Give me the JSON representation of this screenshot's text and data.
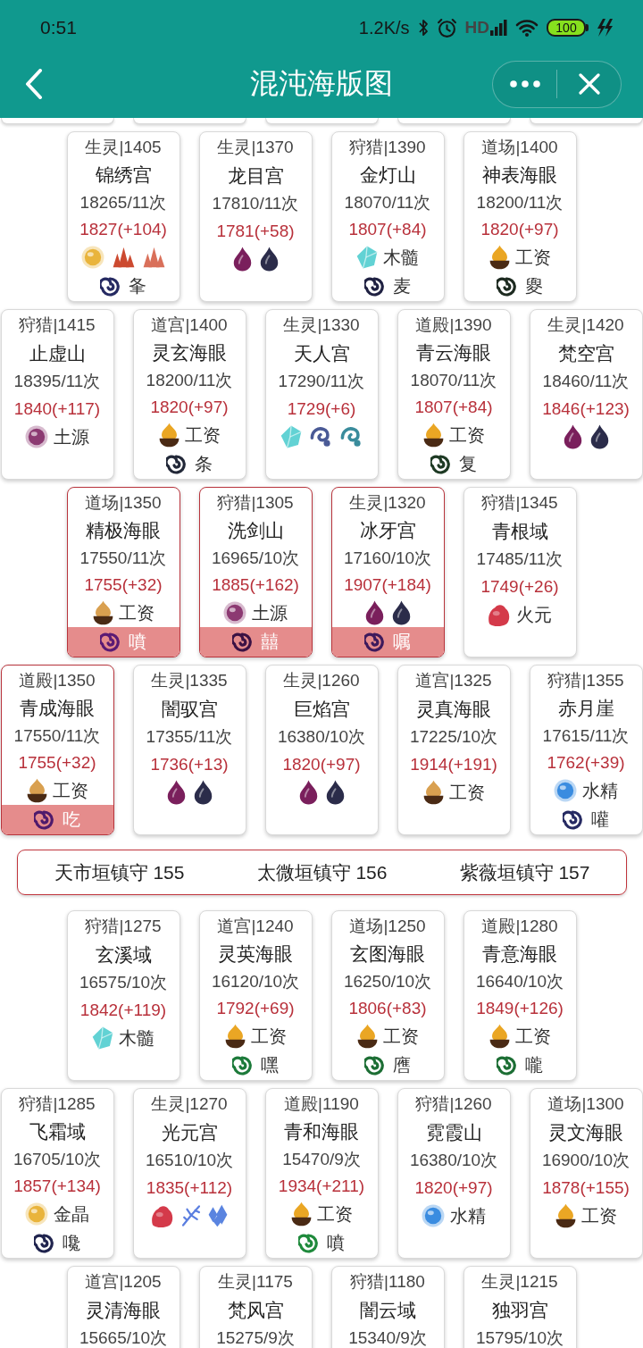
{
  "status_bar": {
    "time": "0:51",
    "net_speed": "1.2K/s",
    "signal_label": "HD",
    "battery": "100"
  },
  "nav": {
    "title": "混沌海版图"
  },
  "clipped_row": [
    {
      "kind": "card"
    },
    {
      "kind": "card"
    },
    {
      "kind": "card"
    },
    {
      "kind": "card"
    },
    {
      "kind": "card"
    }
  ],
  "rows": [
    {
      "kind": "cards",
      "cards": [
        {
          "header": "生灵|1405",
          "name": "锦绣宫",
          "count": "18265/11次",
          "power": "1827(+104)",
          "highlighted": false,
          "rewards": [
            {
              "kind": "orb",
              "color": "#e9b43c"
            },
            {
              "kind": "shards",
              "color": "#cc4a30"
            },
            {
              "kind": "shards",
              "color": "#d9705a"
            }
          ],
          "guard": {
            "label": "夆",
            "color": "#262a62"
          }
        },
        {
          "header": "生灵|1370",
          "name": "龙目宫",
          "count": "17810/11次",
          "power": "1781(+58)",
          "highlighted": false,
          "rewards": [
            {
              "kind": "flame",
              "color": "#7a1f5c"
            },
            {
              "kind": "flame",
              "color": "#2b2c4a"
            }
          ]
        },
        {
          "header": "狩猎|1390",
          "name": "金灯山",
          "count": "18070/11次",
          "power": "1807(+84)",
          "highlighted": false,
          "rewards": [
            {
              "kind": "crystal",
              "color": "#62d2d4",
              "label": "木髓"
            }
          ],
          "guard": {
            "label": "麦",
            "color": "#1f2142"
          }
        },
        {
          "header": "道场|1400",
          "name": "神表海眼",
          "count": "18200/11次",
          "power": "1820(+97)",
          "highlighted": false,
          "rewards": [
            {
              "kind": "bowl",
              "color": "#eaa624",
              "label": "工资"
            }
          ],
          "guard": {
            "label": "夓",
            "color": "#1d2a20"
          }
        }
      ]
    },
    {
      "kind": "cards",
      "cards": [
        {
          "header": "狩猎|1415",
          "name": "止虚山",
          "count": "18395/11次",
          "power": "1840(+117)",
          "highlighted": false,
          "rewards": [
            {
              "kind": "orb",
              "color": "#8c3a72",
              "label": "土源"
            }
          ]
        },
        {
          "header": "道宫|1400",
          "name": "灵玄海眼",
          "count": "18200/11次",
          "power": "1820(+97)",
          "highlighted": false,
          "rewards": [
            {
              "kind": "bowl",
              "color": "#eaa624",
              "label": "工资"
            }
          ],
          "guard": {
            "label": "条",
            "color": "#222838"
          }
        },
        {
          "header": "生灵|1330",
          "name": "天人宫",
          "count": "17290/11次",
          "power": "1729(+6)",
          "highlighted": false,
          "rewards": [
            {
              "kind": "crystal",
              "color": "#62d2d4"
            },
            {
              "kind": "coil",
              "color": "#4a5a96"
            },
            {
              "kind": "coil",
              "color": "#3a8c9c"
            }
          ]
        },
        {
          "header": "道殿|1390",
          "name": "青云海眼",
          "count": "18070/11次",
          "power": "1807(+84)",
          "highlighted": false,
          "rewards": [
            {
              "kind": "bowl",
              "color": "#eaa624",
              "label": "工资"
            }
          ],
          "guard": {
            "label": "复",
            "color": "#1e3a24"
          }
        },
        {
          "header": "生灵|1420",
          "name": "梵空宫",
          "count": "18460/11次",
          "power": "1846(+123)",
          "highlighted": false,
          "rewards": [
            {
              "kind": "flame",
              "color": "#7a1f5c"
            },
            {
              "kind": "flame",
              "color": "#2b2c4a"
            }
          ]
        }
      ]
    },
    {
      "kind": "cards",
      "cards": [
        {
          "header": "道场|1350",
          "name": "精极海眼",
          "count": "17550/11次",
          "power": "1755(+32)",
          "highlighted": true,
          "rewards": [
            {
              "kind": "bowl",
              "color": "#d9a050",
              "label": "工资"
            }
          ],
          "guard": {
            "label": "噴",
            "color": "#5a1a74"
          }
        },
        {
          "header": "狩猎|1305",
          "name": "洗剑山",
          "count": "16965/10次",
          "power": "1885(+162)",
          "highlighted": true,
          "rewards": [
            {
              "kind": "orb",
              "color": "#8c3a72",
              "label": "土源"
            }
          ],
          "guard": {
            "label": "囍",
            "color": "#3c1244"
          }
        },
        {
          "header": "生灵|1320",
          "name": "冰牙宫",
          "count": "17160/10次",
          "power": "1907(+184)",
          "highlighted": true,
          "rewards": [
            {
              "kind": "flame",
              "color": "#7a1f5c"
            },
            {
              "kind": "flame",
              "color": "#2b2c4a"
            }
          ],
          "guard": {
            "label": "嘱",
            "color": "#3e1a5c"
          }
        },
        {
          "header": "狩猎|1345",
          "name": "青根域",
          "count": "17485/11次",
          "power": "1749(+26)",
          "highlighted": false,
          "rewards": [
            {
              "kind": "lump",
              "color": "#d43a4a",
              "label": "火元"
            }
          ]
        }
      ]
    },
    {
      "kind": "cards",
      "cards": [
        {
          "header": "道殿|1350",
          "name": "青成海眼",
          "count": "17550/11次",
          "power": "1755(+32)",
          "highlighted": true,
          "rewards": [
            {
              "kind": "bowl",
              "color": "#d9a050",
              "label": "工资"
            }
          ],
          "guard": {
            "label": "吃",
            "color": "#4e1a6c"
          }
        },
        {
          "header": "生灵|1335",
          "name": "闇驭宫",
          "count": "17355/11次",
          "power": "1736(+13)",
          "highlighted": false,
          "rewards": [
            {
              "kind": "flame",
              "color": "#7a1f5c"
            },
            {
              "kind": "flame",
              "color": "#2b2c4a"
            }
          ]
        },
        {
          "header": "生灵|1260",
          "name": "巨焰宫",
          "count": "16380/10次",
          "power": "1820(+97)",
          "highlighted": false,
          "rewards": [
            {
              "kind": "flame",
              "color": "#7a1f5c"
            },
            {
              "kind": "flame",
              "color": "#2b2c4a"
            }
          ]
        },
        {
          "header": "道宫|1325",
          "name": "灵真海眼",
          "count": "17225/10次",
          "power": "1914(+191)",
          "highlighted": false,
          "rewards": [
            {
              "kind": "bowl",
              "color": "#d9a050",
              "label": "工资"
            }
          ]
        },
        {
          "header": "狩猎|1355",
          "name": "赤月崖",
          "count": "17615/11次",
          "power": "1762(+39)",
          "highlighted": false,
          "rewards": [
            {
              "kind": "orb",
              "color": "#3a8ce0",
              "label": "水精"
            }
          ],
          "guard": {
            "label": "嚾",
            "color": "#262a62"
          }
        }
      ]
    },
    {
      "kind": "banner",
      "items": [
        "天市垣镇守 155",
        "太微垣镇守 156",
        "紫薇垣镇守 157"
      ]
    },
    {
      "kind": "cards",
      "cards": [
        {
          "header": "狩猎|1275",
          "name": "玄溪域",
          "count": "16575/10次",
          "power": "1842(+119)",
          "highlighted": false,
          "rewards": [
            {
              "kind": "crystal",
              "color": "#62d2d4",
              "label": "木髓"
            }
          ]
        },
        {
          "header": "道宫|1240",
          "name": "灵英海眼",
          "count": "16120/10次",
          "power": "1792(+69)",
          "highlighted": false,
          "rewards": [
            {
              "kind": "bowl",
              "color": "#eaa624",
              "label": "工资"
            }
          ],
          "guard": {
            "label": "嘿",
            "color": "#1c7a3a"
          }
        },
        {
          "header": "道场|1250",
          "name": "玄图海眼",
          "count": "16250/10次",
          "power": "1806(+83)",
          "highlighted": false,
          "rewards": [
            {
              "kind": "bowl",
              "color": "#eaa624",
              "label": "工资"
            }
          ],
          "guard": {
            "label": "噟",
            "color": "#1c6e34"
          }
        },
        {
          "header": "道殿|1280",
          "name": "青意海眼",
          "count": "16640/10次",
          "power": "1849(+126)",
          "highlighted": false,
          "rewards": [
            {
              "kind": "bowl",
              "color": "#eaa624",
              "label": "工资"
            }
          ],
          "guard": {
            "label": "嚨",
            "color": "#1c6e34"
          }
        }
      ]
    },
    {
      "kind": "cards",
      "cards": [
        {
          "header": "狩猎|1285",
          "name": "飞霜域",
          "count": "16705/10次",
          "power": "1857(+134)",
          "highlighted": false,
          "rewards": [
            {
              "kind": "orb",
              "color": "#e9b43c",
              "label": "金晶"
            }
          ],
          "guard": {
            "label": "嚵",
            "color": "#20244e"
          }
        },
        {
          "header": "生灵|1270",
          "name": "光元宫",
          "count": "16510/10次",
          "power": "1835(+112)",
          "highlighted": false,
          "rewards": [
            {
              "kind": "lump",
              "color": "#d43a4a"
            },
            {
              "kind": "sprig",
              "color": "#5a7ee0"
            },
            {
              "kind": "cluster",
              "color": "#5a84e0"
            }
          ]
        },
        {
          "header": "道殿|1190",
          "name": "青和海眼",
          "count": "15470/9次",
          "power": "1934(+211)",
          "highlighted": false,
          "rewards": [
            {
              "kind": "bowl",
              "color": "#eaa624",
              "label": "工资"
            }
          ],
          "guard": {
            "label": "噴",
            "color": "#1f8a3c"
          }
        },
        {
          "header": "狩猎|1260",
          "name": "霓霞山",
          "count": "16380/10次",
          "power": "1820(+97)",
          "highlighted": false,
          "rewards": [
            {
              "kind": "orb",
              "color": "#3a8ce0",
              "label": "水精"
            }
          ]
        },
        {
          "header": "道场|1300",
          "name": "灵文海眼",
          "count": "16900/10次",
          "power": "1878(+155)",
          "highlighted": false,
          "rewards": [
            {
              "kind": "bowl",
              "color": "#eaa624",
              "label": "工资"
            }
          ]
        }
      ]
    },
    {
      "kind": "cards",
      "cards": [
        {
          "header": "道宫|1205",
          "name": "灵清海眼",
          "count": "15665/10次",
          "highlighted": false
        },
        {
          "header": "生灵|1175",
          "name": "梵风宫",
          "count": "15275/9次",
          "highlighted": false
        },
        {
          "header": "狩猎|1180",
          "name": "闇云域",
          "count": "15340/9次",
          "highlighted": false
        },
        {
          "header": "生灵|1215",
          "name": "独羽宫",
          "count": "15795/10次",
          "highlighted": false
        }
      ]
    }
  ]
}
